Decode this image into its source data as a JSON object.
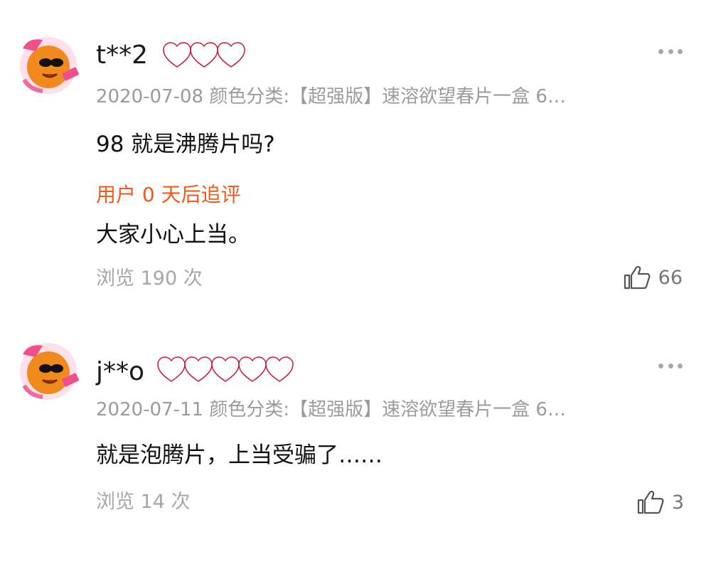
{
  "reviews": [
    {
      "username": "t**2",
      "heart_count": 3,
      "date": "2020-07-08",
      "meta_label": "颜色分类:",
      "variant": "【超强版】速溶欲望春片一盒 6…",
      "content": "98 就是沸腾片吗?",
      "followup_label": "用户 0 天后追评",
      "followup_content": "大家小心上当。",
      "views": "浏览 190 次",
      "likes": "66"
    },
    {
      "username": "j**o",
      "heart_count": 5,
      "date": "2020-07-11",
      "meta_label": "颜色分类:",
      "variant": "【超强版】速溶欲望春片一盒 6…",
      "content": "就是泡腾片，上当受骗了……",
      "views": "浏览 14 次",
      "likes": "3"
    }
  ],
  "colors": {
    "accent_orange": "#f05a1a",
    "heart_red": "#ee3a5a",
    "muted_text": "#9b9b9b"
  },
  "icons": {
    "like": "thumbs-up-icon",
    "more": "more-dots-icon",
    "level": "heart-level-icon"
  }
}
